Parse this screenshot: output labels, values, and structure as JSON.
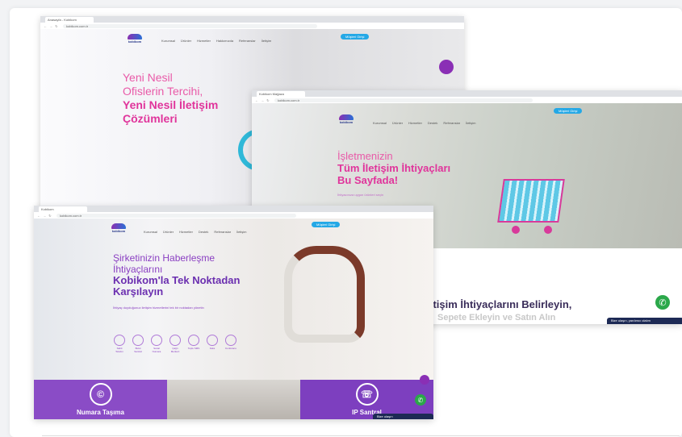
{
  "windows": {
    "w1": {
      "tab": "Anasayfa - Kobikom",
      "url": "kobikom.com.tr",
      "nav": [
        "Kurumsal",
        "Ürünler",
        "Hizmetler",
        "Hakkımızda",
        "Referanslar",
        "İletişim"
      ],
      "cta": "Müşteri Girişi",
      "logo": "kobikom",
      "hero": {
        "line1": "Yeni Nesil",
        "line2": "Ofislerin Tercihi,",
        "line3": "Yeni Nesil İletişim",
        "line4": "Çözümleri"
      }
    },
    "w2": {
      "tab": "Kobikom Mağaza",
      "url": "kobikom.com.tr",
      "nav": [
        "Kurumsal",
        "Ürünler",
        "Hizmetler",
        "Destek",
        "Referanslar",
        "İletişim"
      ],
      "cta": "Müşteri Girişi",
      "logo": "kobikom",
      "hero": {
        "line1": "İşletmenizin",
        "line2": "Tüm İletişim İhtiyaçları",
        "line3": "Bu Sayfada!",
        "sub": "İhtiyacınıza uygun ürünleri seçin"
      },
      "section_title": "İletişim İhtiyaçlarını Belirleyin,",
      "section_sub": "Sepete Ekleyin ve Satın Alın",
      "chat_label": "Bize ulaşın, yardımcı olalım"
    },
    "w3": {
      "tab": "Kobikom",
      "url": "kobikom.com.tr",
      "nav": [
        "Kurumsal",
        "Ürünler",
        "Hizmetler",
        "Destek",
        "Referanslar",
        "İletişim"
      ],
      "cta": "Müşteri Girişi",
      "logo": "kobikom",
      "hero": {
        "line1": "Şirketinizin Haberleşme",
        "line2": "İhtiyaçlarını",
        "line3": "Kobikom'la Tek Noktadan",
        "line4": "Karşılayın",
        "sub": "İhtiyaç duyduğunuz iletişim hizmetlerini tek bir noktadan yönetin"
      },
      "services": [
        "Sabit Telefon",
        "Bulut Santral",
        "Sanal Numara",
        "Çağrı Merkezi",
        "Toplu SMS",
        "Faks",
        "Konferans"
      ],
      "tile1": "Numara Taşıma",
      "tile2": "IP Santral",
      "chat_label": "Bize ulaşın"
    }
  },
  "colors": {
    "pink": "#e0349b",
    "purple": "#8a3fc2",
    "blue": "#24a8e6",
    "green": "#2ba84a"
  }
}
